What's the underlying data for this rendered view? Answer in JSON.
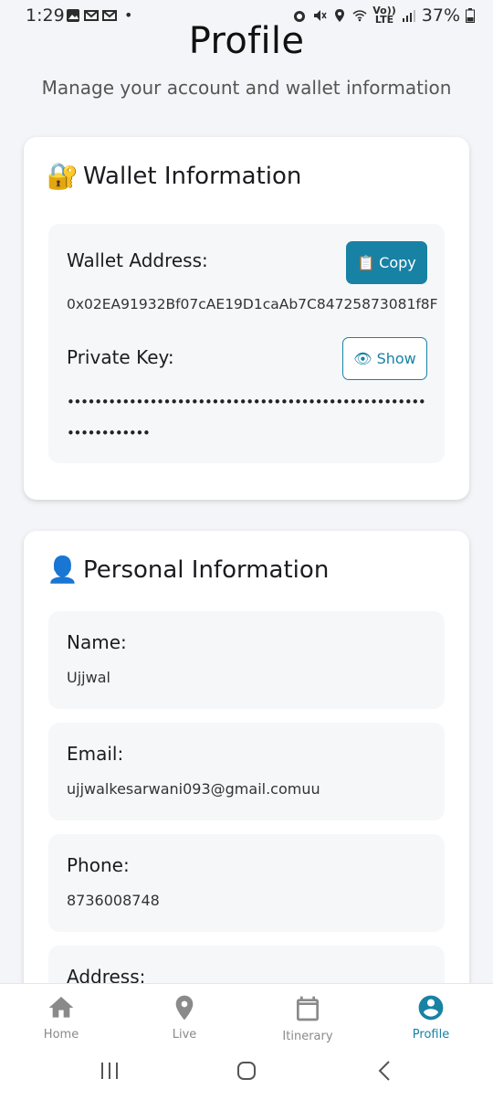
{
  "status_bar": {
    "time": "1:29",
    "battery": "37%",
    "network": "LTE",
    "volte": "Vo))"
  },
  "header": {
    "title": "Profile",
    "subtitle": "Manage your account and wallet information"
  },
  "wallet": {
    "heading_emoji": "🔐",
    "heading": "Wallet Information",
    "address_label": "Wallet Address:",
    "address_value": "0x02EA91932Bf07cAE19D1caAb7C84725873081f8F",
    "copy_icon": "📋",
    "copy_label": "Copy",
    "private_key_label": "Private Key:",
    "show_icon": "👁",
    "show_label": "Show",
    "private_key_masked": "••••••••••••••••••••••••••••••••••••••••••••••••••••••••••••••••"
  },
  "personal": {
    "heading_emoji": "👤",
    "heading": "Personal Information",
    "fields": [
      {
        "label": "Name:",
        "value": "Ujjwal"
      },
      {
        "label": "Email:",
        "value": "ujjwalkesarwani093@gmail.comuu"
      },
      {
        "label": "Phone:",
        "value": "8736008748"
      },
      {
        "label": "Address:",
        "value": ""
      }
    ]
  },
  "bottom_nav": {
    "items": [
      {
        "label": "Home",
        "icon": "home-icon",
        "active": false
      },
      {
        "label": "Live",
        "icon": "location-pin-icon",
        "active": false
      },
      {
        "label": "Itinerary",
        "icon": "calendar-icon",
        "active": false
      },
      {
        "label": "Profile",
        "icon": "account-circle-icon",
        "active": true
      }
    ]
  },
  "colors": {
    "accent": "#1882a5",
    "inactive": "#8a8a8a",
    "panel_bg": "#f6f7f9"
  }
}
